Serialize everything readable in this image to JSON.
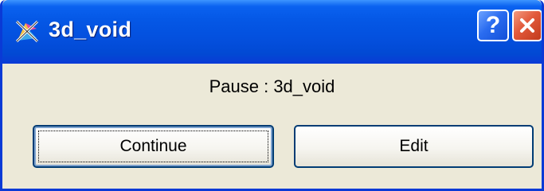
{
  "window": {
    "title": "3d_void",
    "icon": "app-icon"
  },
  "titlebar_buttons": {
    "help_label": "?",
    "help_icon": "help-icon",
    "close_icon": "close-icon"
  },
  "dialog": {
    "message": "Pause : 3d_void",
    "continue_label": "Continue",
    "edit_label": "Edit"
  },
  "colors": {
    "titlebar": "#0558e6",
    "close": "#e2593a",
    "body": "#ece9d8",
    "button_border": "#003c74"
  }
}
